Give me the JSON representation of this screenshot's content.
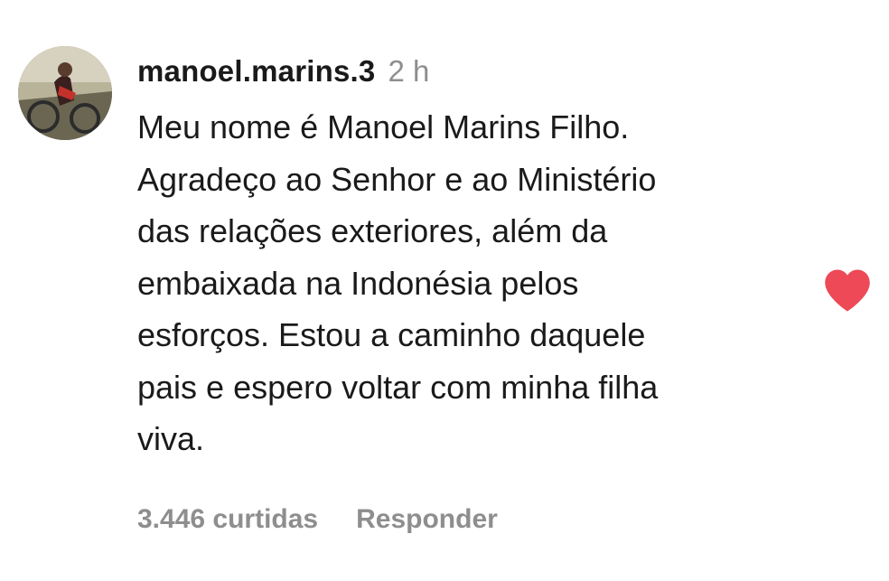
{
  "comment": {
    "username": "manoel.marins.3",
    "time": "2 h",
    "text": "Meu nome é Manoel Marins Filho.\nAgradeço ao Senhor e ao Ministério\ndas relações exteriores, além da\nembaixada na Indonésia pelos\nesforços. Estou a caminho daquele\npais e espero voltar com minha filha\nviva.",
    "likes": "3.446 curtidas",
    "reply_label": "Responder",
    "liked": true,
    "like_icon": "heart-filled-icon",
    "like_color": "#ed4956"
  }
}
